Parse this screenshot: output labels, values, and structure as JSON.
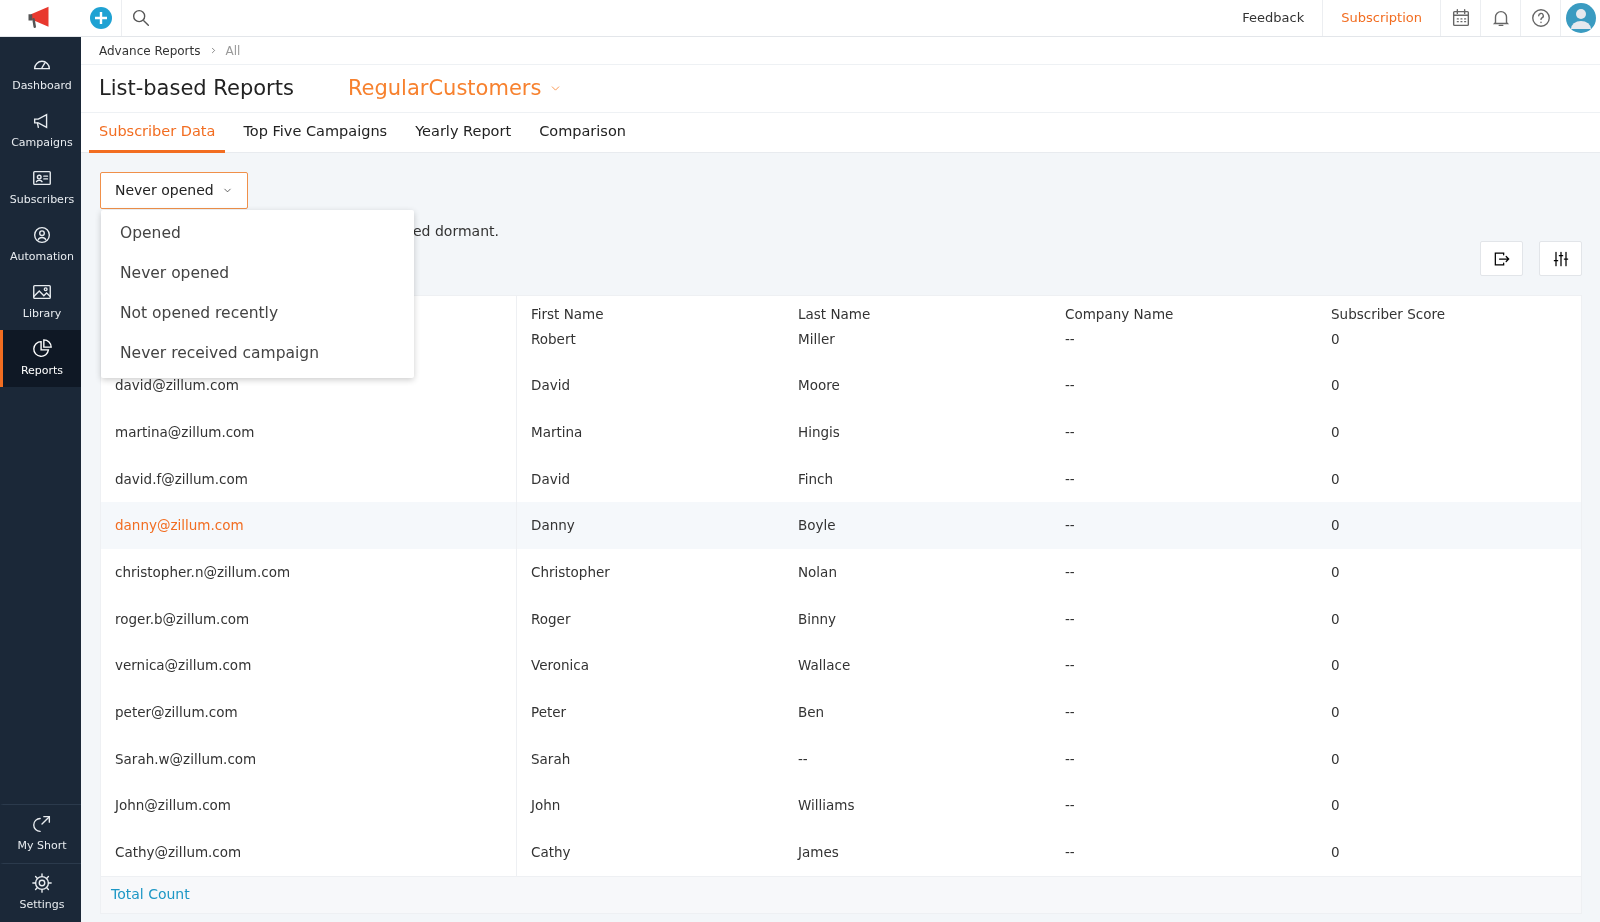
{
  "topbar": {
    "links": [
      {
        "label": "Feedback",
        "highlighted": false
      },
      {
        "label": "Subscription",
        "highlighted": true
      }
    ]
  },
  "sidebar": {
    "items": [
      {
        "label": "Dashboard",
        "kind": "gauge",
        "selected": false
      },
      {
        "label": "Campaigns",
        "kind": "megaphone",
        "selected": false
      },
      {
        "label": "Subscribers",
        "kind": "card",
        "selected": false
      },
      {
        "label": "Automation",
        "kind": "cycle",
        "selected": false
      },
      {
        "label": "Library",
        "kind": "image",
        "selected": false
      },
      {
        "label": "Reports",
        "kind": "pie",
        "selected": true
      }
    ],
    "bottom_items": [
      {
        "label": "My Short",
        "kind": "share",
        "selected": false
      },
      {
        "label": "Settings",
        "kind": "gear",
        "selected": false
      }
    ]
  },
  "breadcrumb": [
    "Advance Reports",
    "All"
  ],
  "page_title": "List-based Reports",
  "list_selector": "RegularCustomers",
  "tabs": [
    {
      "label": "Subscriber Data",
      "selected": true
    },
    {
      "label": "Top Five Campaigns",
      "selected": false
    },
    {
      "label": "Yearly Report",
      "selected": false
    },
    {
      "label": "Comparison",
      "selected": false
    }
  ],
  "filter": {
    "value": "Never opened",
    "expanded": true,
    "options": [
      "Opened",
      "Never opened",
      "Not opened recently",
      "Never received campaign"
    ]
  },
  "description": "ed dormant.",
  "table": {
    "columns": [
      "First Name",
      "Last Name",
      "Company Name",
      "Subscriber Score"
    ],
    "rows": [
      {
        "first_name": "Robert",
        "last_name": "Miller",
        "company": "--",
        "score": "0",
        "selected": false
      },
      {
        "email": "david@zillum.com",
        "first_name": "David",
        "last_name": "Moore",
        "company": "--",
        "score": "0",
        "selected": false
      },
      {
        "email": "martina@zillum.com",
        "first_name": "Martina",
        "last_name": "Hingis",
        "company": "--",
        "score": "0",
        "selected": false
      },
      {
        "email": "david.f@zillum.com",
        "first_name": "David",
        "last_name": "Finch",
        "company": "--",
        "score": "0",
        "selected": false
      },
      {
        "email": "danny@zillum.com",
        "first_name": "Danny",
        "last_name": "Boyle",
        "company": "--",
        "score": "0",
        "selected": true
      },
      {
        "email": "christopher.n@zillum.com",
        "first_name": "Christopher",
        "last_name": "Nolan",
        "company": "--",
        "score": "0",
        "selected": false
      },
      {
        "email": "roger.b@zillum.com",
        "first_name": "Roger",
        "last_name": "Binny",
        "company": "--",
        "score": "0",
        "selected": false
      },
      {
        "email": "vernica@zillum.com",
        "first_name": "Veronica",
        "last_name": "Wallace",
        "company": "--",
        "score": "0",
        "selected": false
      },
      {
        "email": "peter@zillum.com",
        "first_name": "Peter",
        "last_name": "Ben",
        "company": "--",
        "score": "0",
        "selected": false
      },
      {
        "email": "Sarah.w@zillum.com",
        "first_name": "Sarah",
        "last_name": "--",
        "company": "--",
        "score": "0",
        "selected": false
      },
      {
        "email": "John@zillum.com",
        "first_name": "John",
        "last_name": "Williams",
        "company": "--",
        "score": "0",
        "selected": false
      },
      {
        "email": "Cathy@zillum.com",
        "first_name": "Cathy",
        "last_name": "James",
        "company": "--",
        "score": "0",
        "selected": false
      }
    ],
    "footer": "Total Count"
  }
}
